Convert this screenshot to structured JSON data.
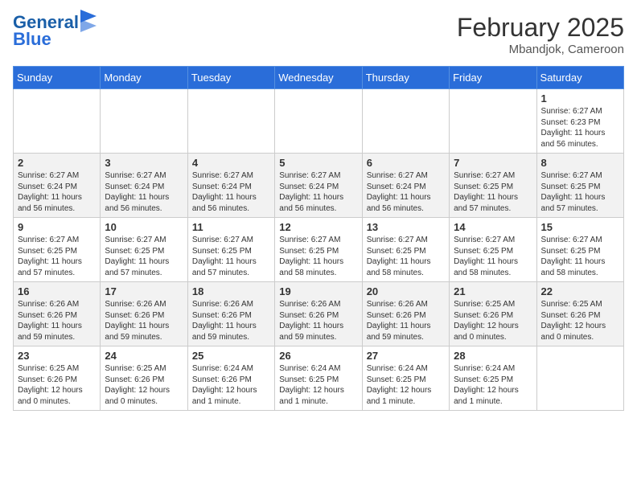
{
  "header": {
    "logo_line1": "General",
    "logo_line2": "Blue",
    "month_year": "February 2025",
    "location": "Mbandjok, Cameroon"
  },
  "weekdays": [
    "Sunday",
    "Monday",
    "Tuesday",
    "Wednesday",
    "Thursday",
    "Friday",
    "Saturday"
  ],
  "weeks": [
    [
      {
        "day": "",
        "info": ""
      },
      {
        "day": "",
        "info": ""
      },
      {
        "day": "",
        "info": ""
      },
      {
        "day": "",
        "info": ""
      },
      {
        "day": "",
        "info": ""
      },
      {
        "day": "",
        "info": ""
      },
      {
        "day": "1",
        "info": "Sunrise: 6:27 AM\nSunset: 6:23 PM\nDaylight: 11 hours and 56 minutes."
      }
    ],
    [
      {
        "day": "2",
        "info": "Sunrise: 6:27 AM\nSunset: 6:24 PM\nDaylight: 11 hours and 56 minutes."
      },
      {
        "day": "3",
        "info": "Sunrise: 6:27 AM\nSunset: 6:24 PM\nDaylight: 11 hours and 56 minutes."
      },
      {
        "day": "4",
        "info": "Sunrise: 6:27 AM\nSunset: 6:24 PM\nDaylight: 11 hours and 56 minutes."
      },
      {
        "day": "5",
        "info": "Sunrise: 6:27 AM\nSunset: 6:24 PM\nDaylight: 11 hours and 56 minutes."
      },
      {
        "day": "6",
        "info": "Sunrise: 6:27 AM\nSunset: 6:24 PM\nDaylight: 11 hours and 56 minutes."
      },
      {
        "day": "7",
        "info": "Sunrise: 6:27 AM\nSunset: 6:25 PM\nDaylight: 11 hours and 57 minutes."
      },
      {
        "day": "8",
        "info": "Sunrise: 6:27 AM\nSunset: 6:25 PM\nDaylight: 11 hours and 57 minutes."
      }
    ],
    [
      {
        "day": "9",
        "info": "Sunrise: 6:27 AM\nSunset: 6:25 PM\nDaylight: 11 hours and 57 minutes."
      },
      {
        "day": "10",
        "info": "Sunrise: 6:27 AM\nSunset: 6:25 PM\nDaylight: 11 hours and 57 minutes."
      },
      {
        "day": "11",
        "info": "Sunrise: 6:27 AM\nSunset: 6:25 PM\nDaylight: 11 hours and 57 minutes."
      },
      {
        "day": "12",
        "info": "Sunrise: 6:27 AM\nSunset: 6:25 PM\nDaylight: 11 hours and 58 minutes."
      },
      {
        "day": "13",
        "info": "Sunrise: 6:27 AM\nSunset: 6:25 PM\nDaylight: 11 hours and 58 minutes."
      },
      {
        "day": "14",
        "info": "Sunrise: 6:27 AM\nSunset: 6:25 PM\nDaylight: 11 hours and 58 minutes."
      },
      {
        "day": "15",
        "info": "Sunrise: 6:27 AM\nSunset: 6:25 PM\nDaylight: 11 hours and 58 minutes."
      }
    ],
    [
      {
        "day": "16",
        "info": "Sunrise: 6:26 AM\nSunset: 6:26 PM\nDaylight: 11 hours and 59 minutes."
      },
      {
        "day": "17",
        "info": "Sunrise: 6:26 AM\nSunset: 6:26 PM\nDaylight: 11 hours and 59 minutes."
      },
      {
        "day": "18",
        "info": "Sunrise: 6:26 AM\nSunset: 6:26 PM\nDaylight: 11 hours and 59 minutes."
      },
      {
        "day": "19",
        "info": "Sunrise: 6:26 AM\nSunset: 6:26 PM\nDaylight: 11 hours and 59 minutes."
      },
      {
        "day": "20",
        "info": "Sunrise: 6:26 AM\nSunset: 6:26 PM\nDaylight: 11 hours and 59 minutes."
      },
      {
        "day": "21",
        "info": "Sunrise: 6:25 AM\nSunset: 6:26 PM\nDaylight: 12 hours and 0 minutes."
      },
      {
        "day": "22",
        "info": "Sunrise: 6:25 AM\nSunset: 6:26 PM\nDaylight: 12 hours and 0 minutes."
      }
    ],
    [
      {
        "day": "23",
        "info": "Sunrise: 6:25 AM\nSunset: 6:26 PM\nDaylight: 12 hours and 0 minutes."
      },
      {
        "day": "24",
        "info": "Sunrise: 6:25 AM\nSunset: 6:26 PM\nDaylight: 12 hours and 0 minutes."
      },
      {
        "day": "25",
        "info": "Sunrise: 6:24 AM\nSunset: 6:26 PM\nDaylight: 12 hours and 1 minute."
      },
      {
        "day": "26",
        "info": "Sunrise: 6:24 AM\nSunset: 6:25 PM\nDaylight: 12 hours and 1 minute."
      },
      {
        "day": "27",
        "info": "Sunrise: 6:24 AM\nSunset: 6:25 PM\nDaylight: 12 hours and 1 minute."
      },
      {
        "day": "28",
        "info": "Sunrise: 6:24 AM\nSunset: 6:25 PM\nDaylight: 12 hours and 1 minute."
      },
      {
        "day": "",
        "info": ""
      }
    ]
  ]
}
